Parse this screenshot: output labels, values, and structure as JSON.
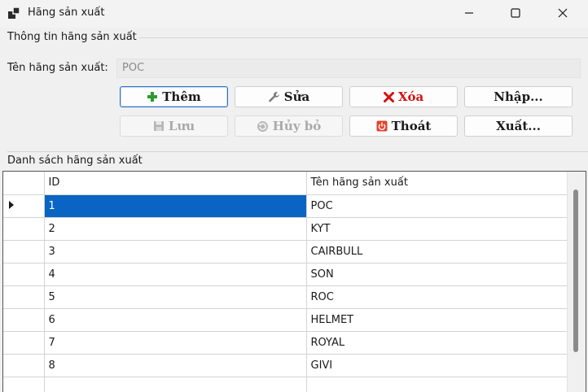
{
  "window": {
    "title": "Hãng sản xuất"
  },
  "info_group": {
    "title": "Thông tin hãng sản xuất",
    "name_label": "Tên hãng sản xuất:",
    "name_value": "POC"
  },
  "buttons": {
    "add": "Thêm",
    "edit": "Sửa",
    "delete": "Xóa",
    "import": "Nhập...",
    "save": "Lưu",
    "cancel": "Hủy bỏ",
    "exit": "Thoát",
    "export": "Xuất..."
  },
  "list_group": {
    "title": "Danh sách hãng sản xuất"
  },
  "grid": {
    "columns": [
      "ID",
      "Tên hãng sản xuất"
    ],
    "rows": [
      {
        "id": "1",
        "name": "POC"
      },
      {
        "id": "2",
        "name": "KYT"
      },
      {
        "id": "3",
        "name": "CAIRBULL"
      },
      {
        "id": "4",
        "name": "SON"
      },
      {
        "id": "5",
        "name": "ROC"
      },
      {
        "id": "6",
        "name": "HELMET"
      },
      {
        "id": "7",
        "name": "ROYAL"
      },
      {
        "id": "8",
        "name": "GIVI"
      }
    ],
    "selected_row": 0
  },
  "colors": {
    "selection": "#0a64c4",
    "delete_text": "#d51010",
    "primary_border": "#2a6ec9"
  }
}
